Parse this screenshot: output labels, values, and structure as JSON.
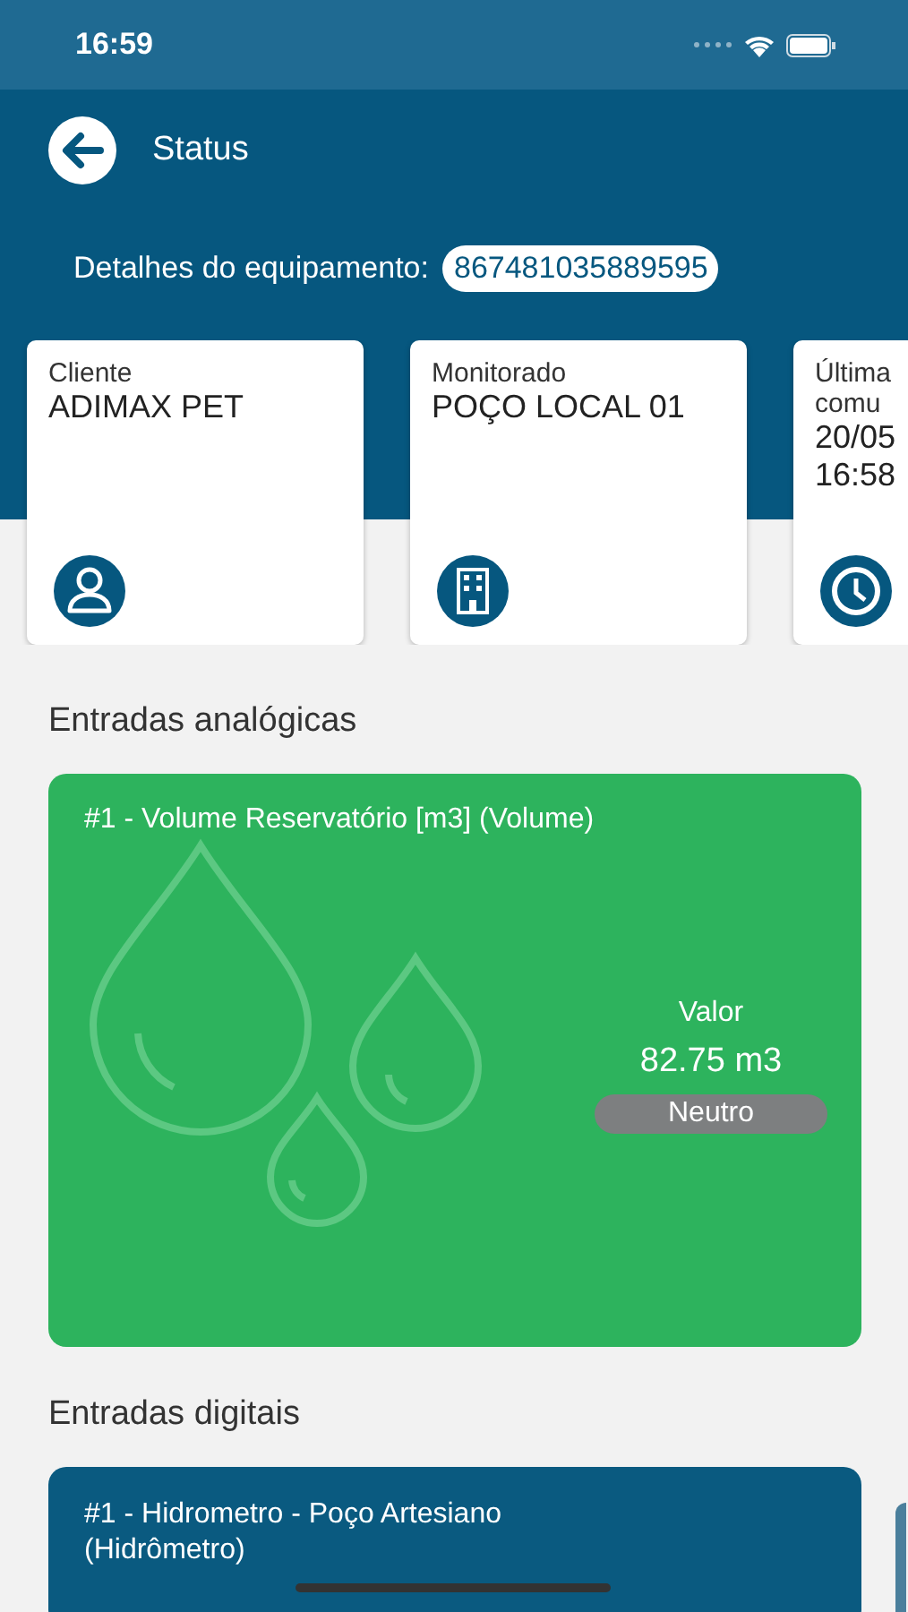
{
  "status_bar": {
    "time": "16:59"
  },
  "header": {
    "title": "Status",
    "equipment_label": "Detalhes do equipamento:",
    "equipment_id": "867481035889595"
  },
  "cards": [
    {
      "label": "Cliente",
      "value": "ADIMAX PET",
      "kind": "person"
    },
    {
      "label": "Monitorado",
      "value": "POÇO LOCAL 01",
      "kind": "building"
    },
    {
      "label": "Última\ncomu",
      "value": "20/05\n16:58",
      "kind": "clock"
    }
  ],
  "analog": {
    "title": "Entradas analógicas",
    "items": [
      {
        "name": "#1 - Volume Reservatório [m3] (Volume)",
        "value_label": "Valor",
        "value": "82.75 m3",
        "status": "Neutro"
      }
    ]
  },
  "digital": {
    "title": "Entradas digitais",
    "items": [
      {
        "name": "#1 - Hidrometro - Poço Artesiano (Hidrômetro)"
      }
    ]
  }
}
